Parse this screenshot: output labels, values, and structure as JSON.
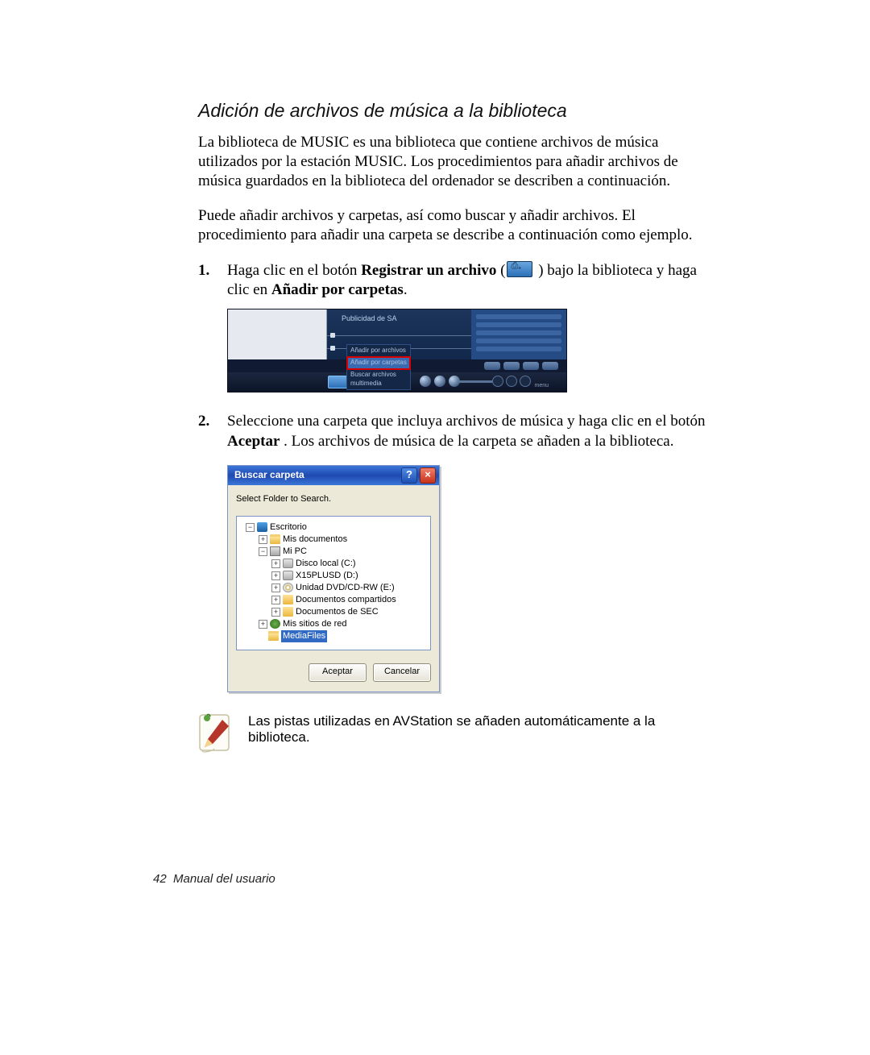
{
  "section_title": "Adición de archivos de música a la biblioteca",
  "para1": "La biblioteca de MUSIC es una biblioteca que contiene archivos de música utilizados por la estación MUSIC. Los procedimientos para añadir archivos de música guardados en la biblioteca del ordenador se describen a continuación.",
  "para2": "Puede añadir archivos y carpetas, así como buscar y añadir archivos. El procedimiento para añadir una carpeta se describe a continuación como ejemplo.",
  "steps": {
    "s1": {
      "num": "1.",
      "pre": "Haga clic en el botón ",
      "bold1": "Registrar un archivo",
      "mid": "(",
      "post": " ) bajo la biblioteca y haga clic en ",
      "bold2": "Añadir por carpetas",
      "tail": "."
    },
    "s2": {
      "num": "2.",
      "pre": "Seleccione una carpeta que incluya archivos de música y haga clic en el botón ",
      "bold1": "Aceptar",
      "post": ". Los archivos de música de la carpeta se añaden a la biblioteca."
    }
  },
  "player": {
    "label": "Publicidad de SA",
    "dropdown": [
      "Añadir por archivos",
      "Añadir por carpetas",
      "Buscar archivos multimedia"
    ]
  },
  "dialog": {
    "title": "Buscar carpeta",
    "subtitle": "Select Folder to Search.",
    "tree": {
      "desktop": "Escritorio",
      "mydocs": "Mis documentos",
      "mypc": "Mi PC",
      "diskc": "Disco local (C:)",
      "diskd": "X15PLUSD (D:)",
      "dvd": "Unidad DVD/CD-RW (E:)",
      "shared": "Documentos compartidos",
      "sec": "Documentos de SEC",
      "network": "Mis sitios de red",
      "mediafiles": "MediaFiles"
    },
    "ok": "Aceptar",
    "cancel": "Cancelar"
  },
  "note_text": "Las pistas utilizadas en AVStation se añaden automáticamente a la biblioteca.",
  "footer": {
    "page": "42",
    "label": "Manual del usuario"
  }
}
